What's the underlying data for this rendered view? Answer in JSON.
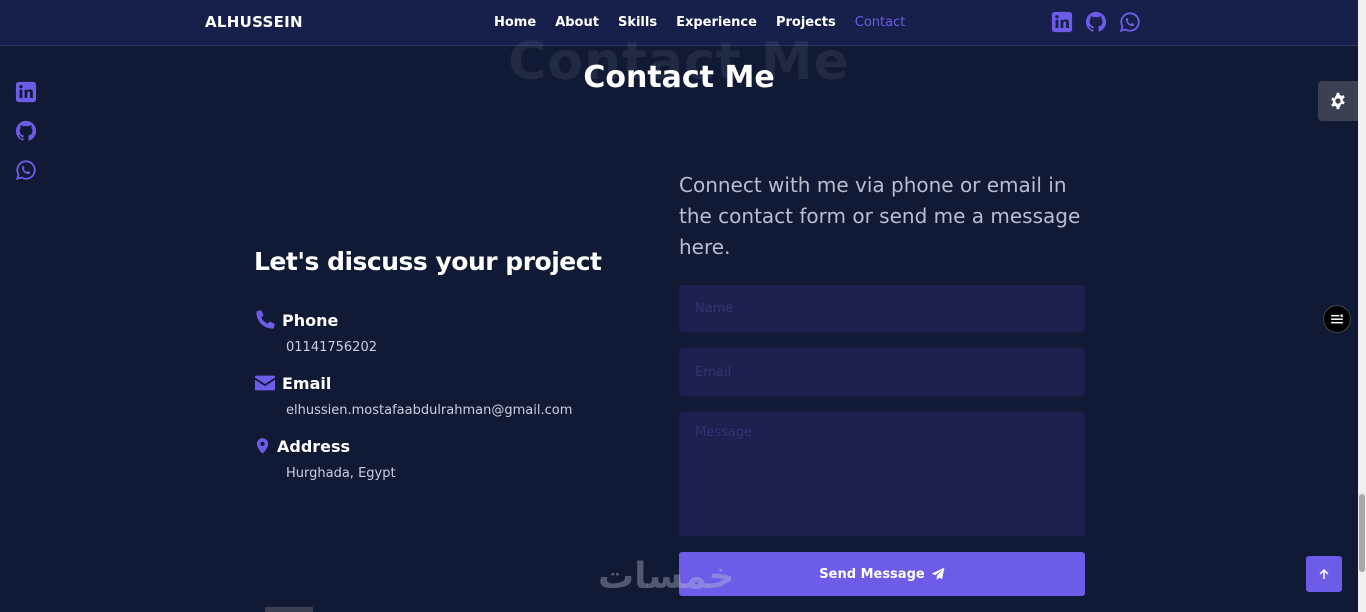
{
  "navbar": {
    "brand": "ALHUSSEIN",
    "links": [
      {
        "label": "Home",
        "active": false
      },
      {
        "label": "About",
        "active": false
      },
      {
        "label": "Skills",
        "active": false
      },
      {
        "label": "Experience",
        "active": false
      },
      {
        "label": "Projects",
        "active": false
      },
      {
        "label": "Contact",
        "active": true
      }
    ],
    "social_icons": [
      "linkedin-icon",
      "github-icon",
      "whatsapp-icon"
    ]
  },
  "side_social_icons": [
    "linkedin-icon",
    "github-icon",
    "whatsapp-icon"
  ],
  "section": {
    "bg_title": "Contact Me",
    "title": "Contact Me"
  },
  "info": {
    "heading": "Let's discuss your project",
    "phone": {
      "label": "Phone",
      "value": "01141756202",
      "icon": "phone-icon"
    },
    "email": {
      "label": "Email",
      "value": "elhussien.mostafaabdulrahman@gmail.com",
      "icon": "envelope-icon"
    },
    "address": {
      "label": "Address",
      "value": "Hurghada, Egypt",
      "icon": "map-marker-icon"
    }
  },
  "form": {
    "intro": "Connect with me via phone or email in the contact form or send me a message here.",
    "name_placeholder": "Name",
    "email_placeholder": "Email",
    "message_placeholder": "Message",
    "send_label": "Send Message"
  },
  "watermark": "خمسات",
  "colors": {
    "accent": "#6c5ce7",
    "background": "#111a35",
    "navbar": "#16204a",
    "field": "#1c2150"
  }
}
